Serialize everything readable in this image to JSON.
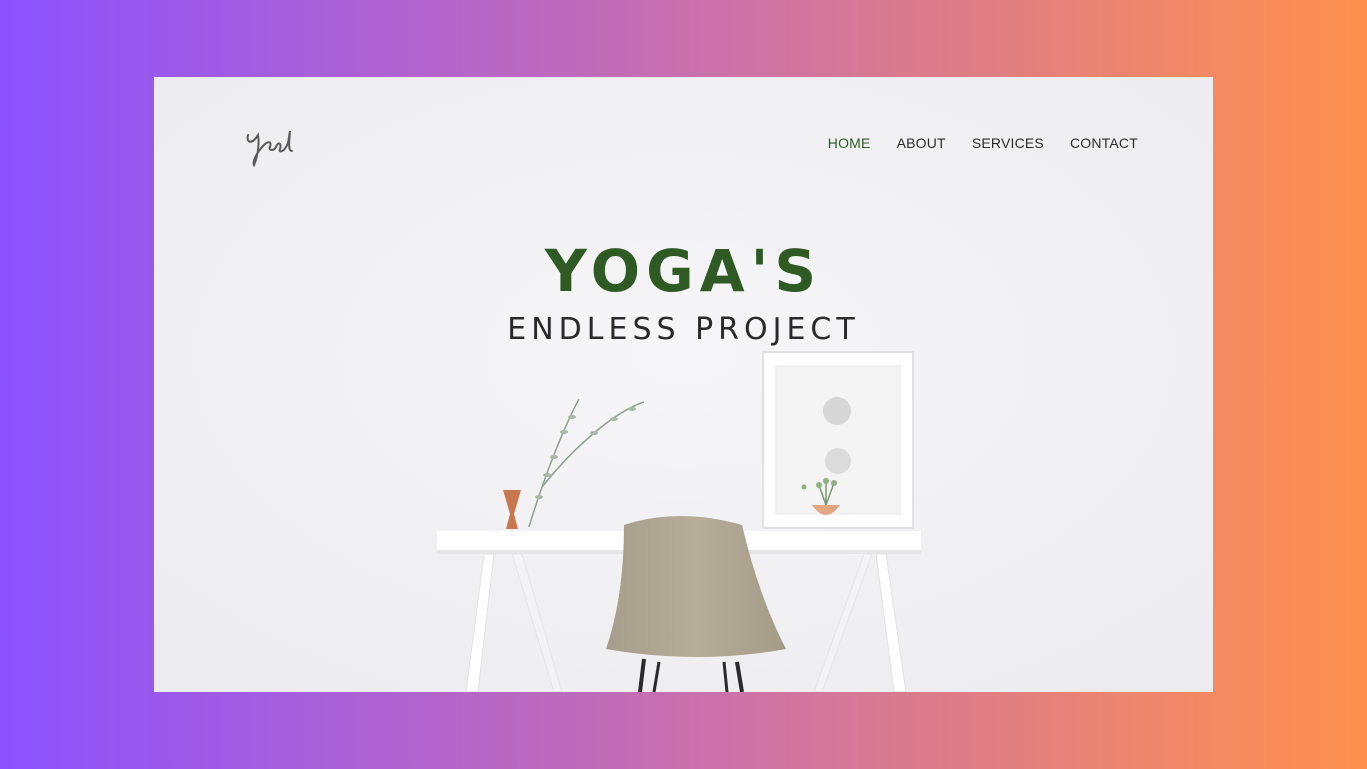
{
  "logo": {
    "text": "Yad",
    "icon": "signature-logo"
  },
  "nav": {
    "items": [
      {
        "label": "HOME",
        "active": true
      },
      {
        "label": "ABOUT",
        "active": false
      },
      {
        "label": "SERVICES",
        "active": false
      },
      {
        "label": "CONTACT",
        "active": false
      }
    ]
  },
  "hero": {
    "title": "YOGA'S",
    "subtitle": "ENDLESS PROJECT"
  },
  "colors": {
    "accent": "#2f5a24",
    "nav_text": "#2b2b2b",
    "background_from": "#8c52ff",
    "background_to": "#ff914d"
  }
}
